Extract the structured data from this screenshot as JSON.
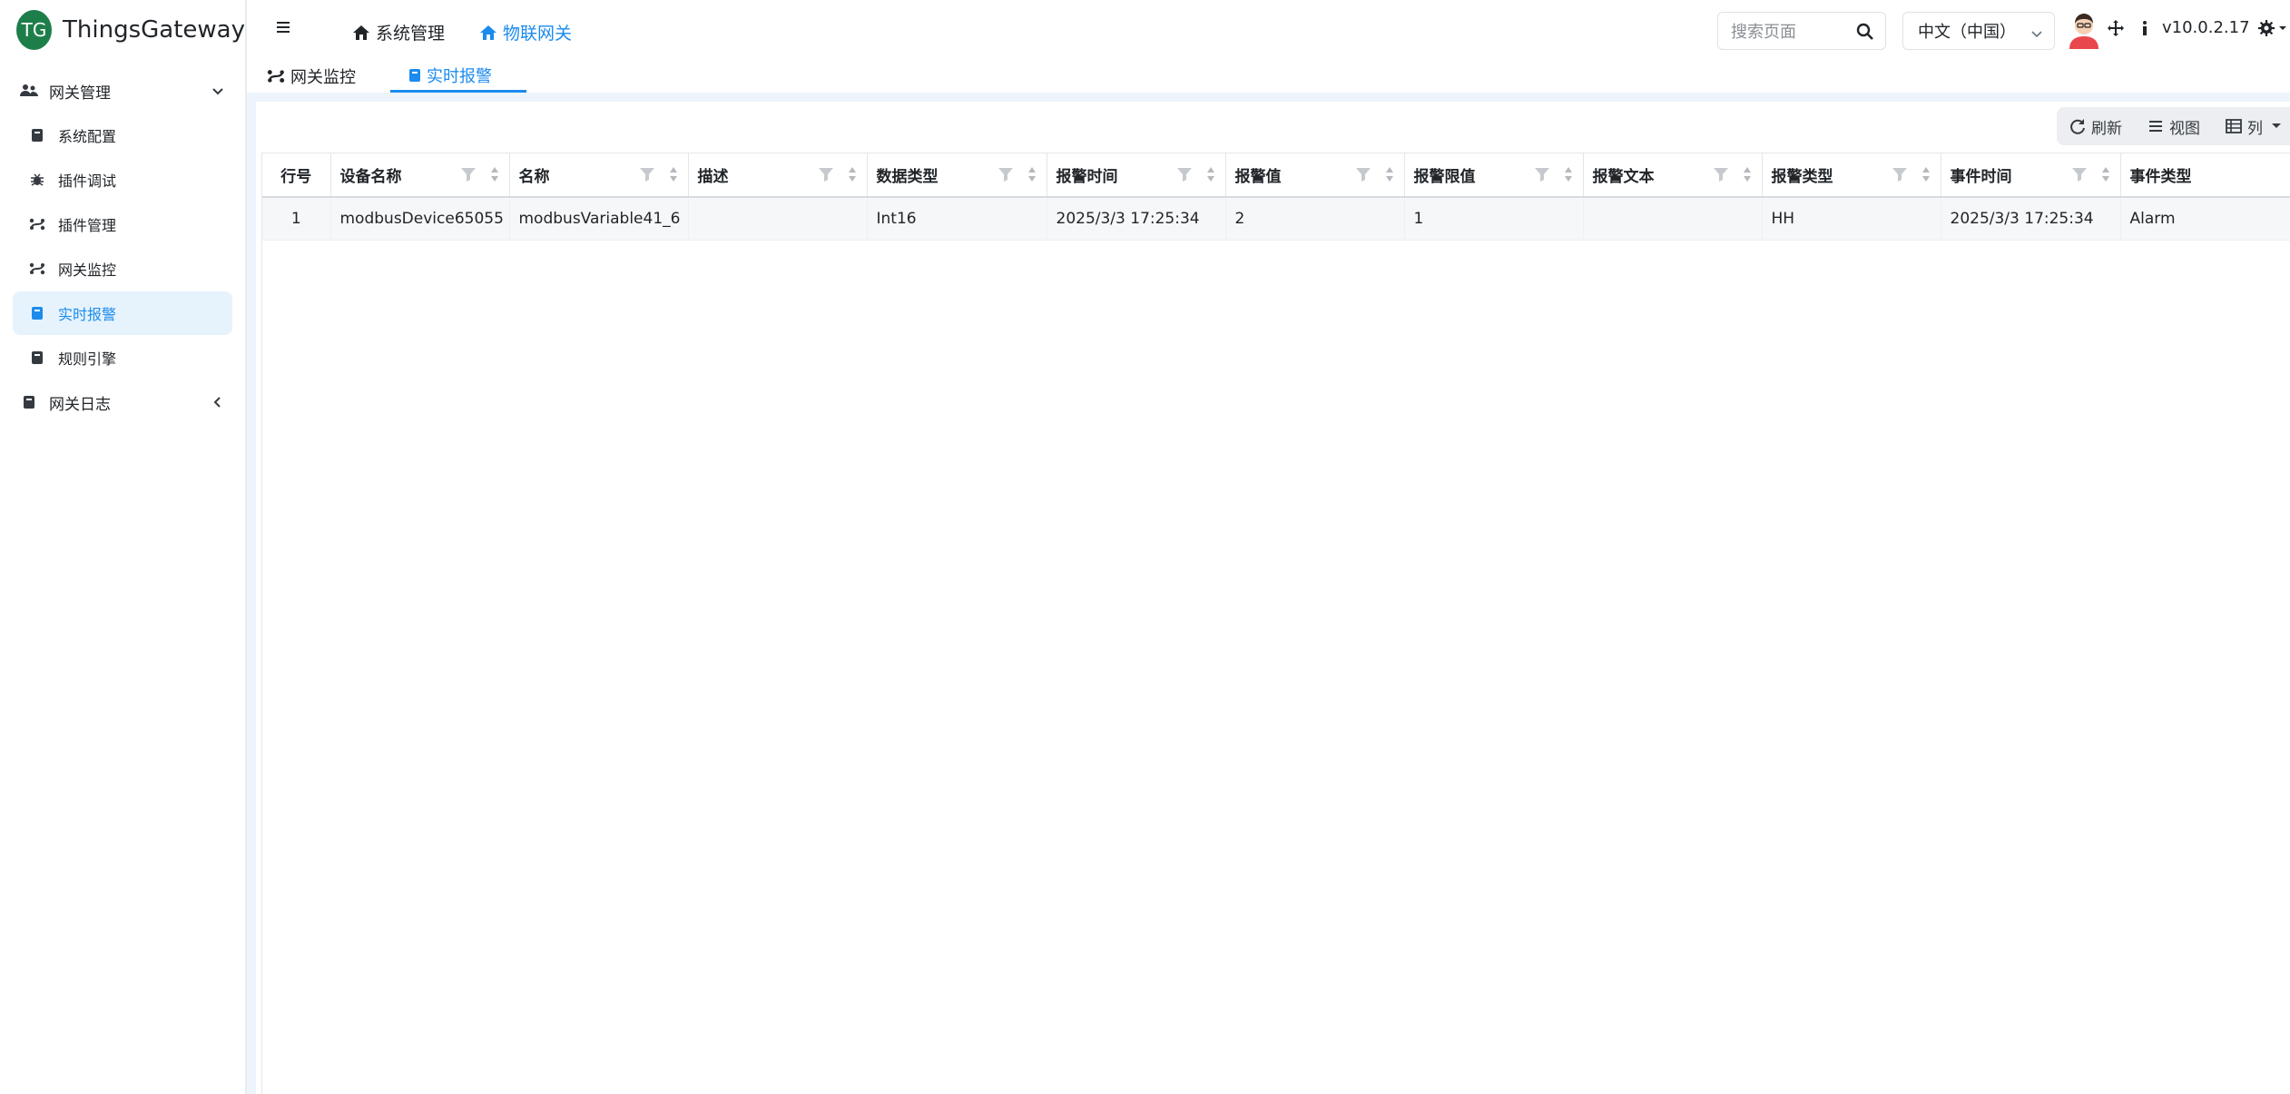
{
  "app": {
    "logo_text": "TG",
    "name": "ThingsGateway"
  },
  "sidebar": {
    "groups": [
      {
        "label": "网关管理",
        "expanded": true
      },
      {
        "label": "网关日志",
        "expanded": false
      }
    ],
    "items": [
      {
        "label": "系统配置",
        "icon": "book-icon"
      },
      {
        "label": "插件调试",
        "icon": "bug-icon"
      },
      {
        "label": "插件管理",
        "icon": "route-icon"
      },
      {
        "label": "网关监控",
        "icon": "route-icon"
      },
      {
        "label": "实时报警",
        "icon": "book-icon",
        "active": true
      },
      {
        "label": "规则引擎",
        "icon": "book-icon"
      }
    ]
  },
  "header": {
    "tabs": [
      {
        "label": "系统管理",
        "active": false
      },
      {
        "label": "物联网关",
        "active": true
      }
    ],
    "search_placeholder": "搜索页面",
    "language": "中文（中国）",
    "version": "v10.0.2.17"
  },
  "subtabs": [
    {
      "label": "网关监控",
      "active": false
    },
    {
      "label": "实时报警",
      "active": true
    }
  ],
  "toolbar": {
    "refresh": "刷新",
    "view": "视图",
    "columns": "列"
  },
  "table": {
    "columns": [
      "行号",
      "设备名称",
      "名称",
      "描述",
      "数据类型",
      "报警时间",
      "报警值",
      "报警限值",
      "报警文本",
      "报警类型",
      "事件时间",
      "事件类型"
    ],
    "rows": [
      [
        "1",
        "modbusDevice65055",
        "modbusVariable41_6",
        "",
        "Int16",
        "2025/3/3 17:25:34",
        "2",
        "1",
        "",
        "HH",
        "2025/3/3 17:25:34",
        "Alarm"
      ]
    ]
  },
  "colors": {
    "accent": "#1b8bed",
    "brand": "#1e7e4a",
    "active_bg": "#e6f3fd"
  }
}
